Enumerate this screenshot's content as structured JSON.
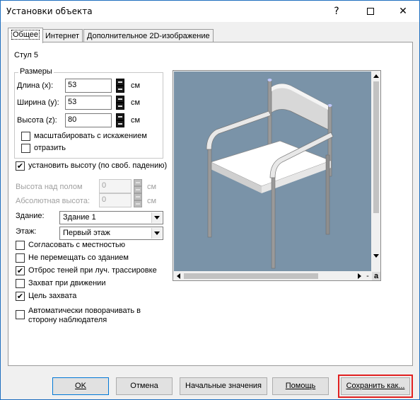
{
  "window": {
    "title": "Установки объекта",
    "help_glyph": "?",
    "close_glyph": "✕"
  },
  "tabs": [
    {
      "label": "Общее",
      "active": true
    },
    {
      "label": "Интернет",
      "active": false
    },
    {
      "label": "Дополнительное 2D-изображение",
      "active": false
    }
  ],
  "object_name": "Стул 5",
  "sizes": {
    "legend": "Размеры",
    "length_label": "Длина (x):",
    "length_value": "53",
    "width_label": "Ширина (y):",
    "width_value": "53",
    "height_label": "Высота (z):",
    "height_value": "80",
    "unit": "см",
    "scale_label": "масштабировать с  искажением",
    "scale_checked": false,
    "mirror_label": "отразить",
    "mirror_checked": false
  },
  "set_height": {
    "label": "установить высоту (по своб. падению)",
    "checked": true
  },
  "floor_height": {
    "label": "Высота над полом",
    "value": "0",
    "unit": "см"
  },
  "absolute_height": {
    "label": "Абсолютная высота:",
    "value": "0",
    "unit": "см"
  },
  "building": {
    "label": "Здание:",
    "value": "Здание 1"
  },
  "storey": {
    "label": "Этаж:",
    "value": "Первый этаж"
  },
  "options": [
    {
      "label": "Согласовать с местностью",
      "checked": false
    },
    {
      "label": "Не перемещать со зданием",
      "checked": false
    },
    {
      "label": "Отброс теней при луч. трассировке",
      "checked": true
    },
    {
      "label": "Захват при движении",
      "checked": false
    },
    {
      "label": "Цель захвата",
      "checked": true
    }
  ],
  "auto_rotate": {
    "line1": "Автоматически поворачивать в",
    "line2": "сторону наблюдателя",
    "checked": false
  },
  "preview": {
    "background": "#7a93a8",
    "zoom_minus": "-",
    "zoom_a": "a"
  },
  "buttons": {
    "ok": "OK",
    "cancel": "Отмена",
    "defaults": "Начальные значения",
    "help": "Помощь",
    "save_as": "Сохранить как..."
  },
  "check_glyph": "✔"
}
